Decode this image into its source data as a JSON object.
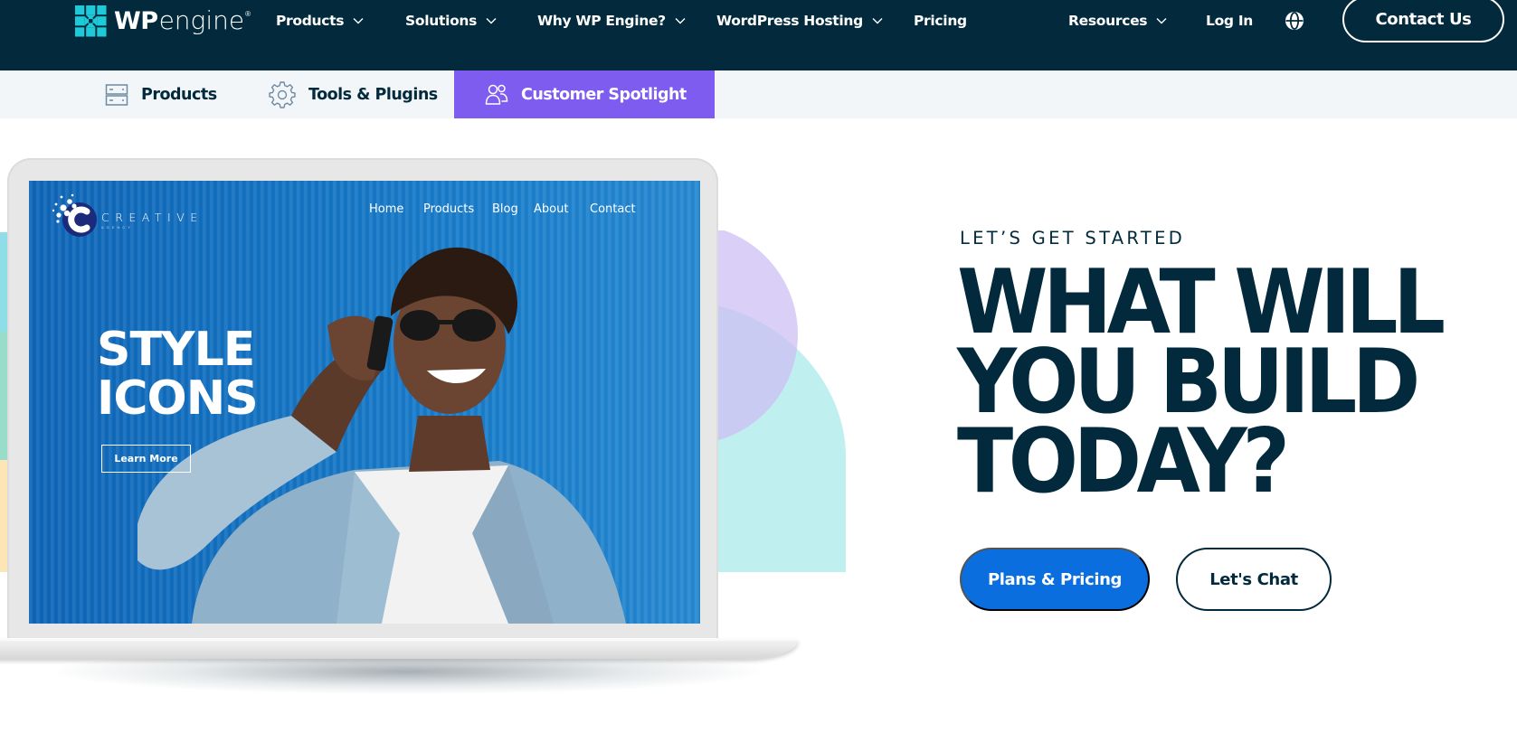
{
  "header": {
    "brand": {
      "wp": "WP",
      "engine": "engine",
      "reg": "®"
    },
    "nav": [
      {
        "label": "Products",
        "has_dropdown": true
      },
      {
        "label": "Solutions",
        "has_dropdown": true
      },
      {
        "label": "Why WP Engine?",
        "has_dropdown": true
      },
      {
        "label": "WordPress Hosting",
        "has_dropdown": true
      },
      {
        "label": "Pricing",
        "has_dropdown": false
      },
      {
        "label": "Resources",
        "has_dropdown": true
      },
      {
        "label": "Log In",
        "has_dropdown": false
      }
    ],
    "language_icon": "globe-icon",
    "contact_label": "Contact Us"
  },
  "subnav": {
    "items": [
      {
        "label": "Products",
        "icon": "server-icon",
        "active": false
      },
      {
        "label": "Tools & Plugins",
        "icon": "gear-icon",
        "active": false
      },
      {
        "label": "Customer Spotlight",
        "icon": "users-icon",
        "active": true
      }
    ]
  },
  "hero": {
    "mockup": {
      "brand": "CREATIVE",
      "brand_sub": "AGENCY",
      "nav": [
        "Home",
        "Products",
        "Blog",
        "About",
        "Contact"
      ],
      "headline_lines": [
        "STYLE",
        "ICONS"
      ],
      "cta_label": "Learn More"
    },
    "eyebrow": "LET’S GET STARTED",
    "headline_lines": [
      "WHAT WILL",
      "YOU BUILD",
      "TODAY?"
    ],
    "primary_cta": "Plans & Pricing",
    "secondary_cta": "Let's Chat"
  },
  "colors": {
    "nav_bg": "#022a3c",
    "subnav_bg": "#f3f6f9",
    "active_tab": "#7e5cef",
    "primary_button": "#0b6ede",
    "logo_teal": "#1ec9d9",
    "heading": "#022a3c"
  }
}
